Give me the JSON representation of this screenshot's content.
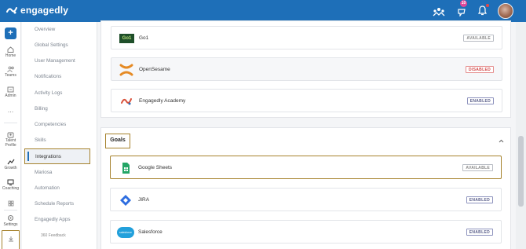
{
  "header": {
    "brand": "engagedly",
    "notification_count": "10"
  },
  "rail": {
    "add_label": "+",
    "items": {
      "home": "Home",
      "teams": "Teams",
      "admin": "Admin",
      "more": "...",
      "talent_profile": "Talent Profile",
      "growth": "Growth",
      "coaching": "Coaching",
      "settings": "Settings"
    }
  },
  "admin_nav": {
    "items": [
      "Overview",
      "Global Settings",
      "User Management",
      "Notifications",
      "Activity Logs",
      "Billing",
      "Competencies",
      "Skills",
      "Integrations",
      "Mariosa",
      "Automation",
      "Schedule Reports",
      "Engagedly Apps"
    ],
    "active": "Integrations",
    "sub_item": "360 Feedback"
  },
  "sections": {
    "learning_rows": [
      {
        "name": "Go1",
        "status": "AVAILABLE",
        "logo": "go1-logo"
      },
      {
        "name": "OpenSesame",
        "status": "DISABLED",
        "logo": "opensesame-logo"
      },
      {
        "name": "Engagedly Academy",
        "status": "ENABLED",
        "logo": "engagedly-academy-logo"
      }
    ],
    "goals": {
      "title": "Goals",
      "rows": [
        {
          "name": "Google Sheets",
          "status": "AVAILABLE",
          "logo": "google-sheets-logo"
        },
        {
          "name": "JIRA",
          "status": "ENABLED",
          "logo": "jira-logo"
        },
        {
          "name": "Salesforce",
          "status": "ENABLED",
          "logo": "salesforce-logo"
        }
      ]
    }
  },
  "logo_texts": {
    "go1": "Go1",
    "salesforce": "salesforce"
  },
  "colors": {
    "brand": "#1e6fb8",
    "highlight": "#a6822d",
    "disabled": "#d14646",
    "enabled": "#5a5f8a"
  }
}
